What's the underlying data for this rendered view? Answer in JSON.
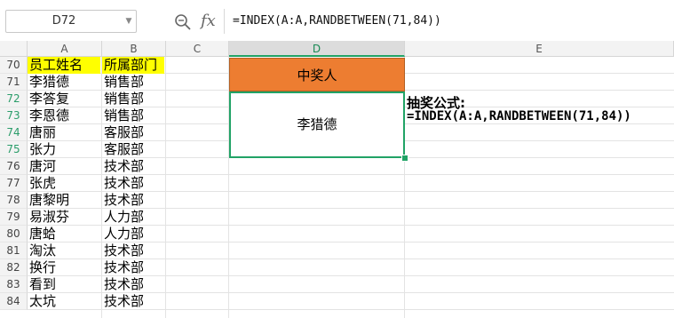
{
  "formula_bar": {
    "name_box": "D72",
    "fx_label": "fx",
    "formula": "=INDEX(A:A,RANDBETWEEN(71,84))"
  },
  "columns": [
    "A",
    "B",
    "C",
    "D",
    "E"
  ],
  "rows": [
    {
      "num": "70",
      "name": "员工姓名",
      "dept": "所属部门"
    },
    {
      "num": "71",
      "name": "李猎德",
      "dept": "销售部"
    },
    {
      "num": "72",
      "name": "李答复",
      "dept": "销售部"
    },
    {
      "num": "73",
      "name": "李恩德",
      "dept": "销售部"
    },
    {
      "num": "74",
      "name": "唐丽",
      "dept": "客服部"
    },
    {
      "num": "75",
      "name": "张力",
      "dept": "客服部"
    },
    {
      "num": "76",
      "name": "唐河",
      "dept": "技术部"
    },
    {
      "num": "77",
      "name": "张虎",
      "dept": "技术部"
    },
    {
      "num": "78",
      "name": "唐黎明",
      "dept": "技术部"
    },
    {
      "num": "79",
      "name": "易淑芬",
      "dept": "人力部"
    },
    {
      "num": "80",
      "name": "唐蛤",
      "dept": "人力部"
    },
    {
      "num": "81",
      "name": "淘汰",
      "dept": "技术部"
    },
    {
      "num": "82",
      "name": "换行",
      "dept": "技术部"
    },
    {
      "num": "83",
      "name": "看到",
      "dept": "技术部"
    },
    {
      "num": "84",
      "name": "太坑",
      "dept": "技术部"
    }
  ],
  "winner": {
    "header": "中奖人",
    "value": "李猎德"
  },
  "note": {
    "title": "抽奖公式:",
    "formula": "=INDEX(A:A,RANDBETWEEN(71,84))"
  },
  "colors": {
    "header_fill": "#ffff00",
    "winner_header_fill": "#ed7d31",
    "selection": "#21a366"
  }
}
